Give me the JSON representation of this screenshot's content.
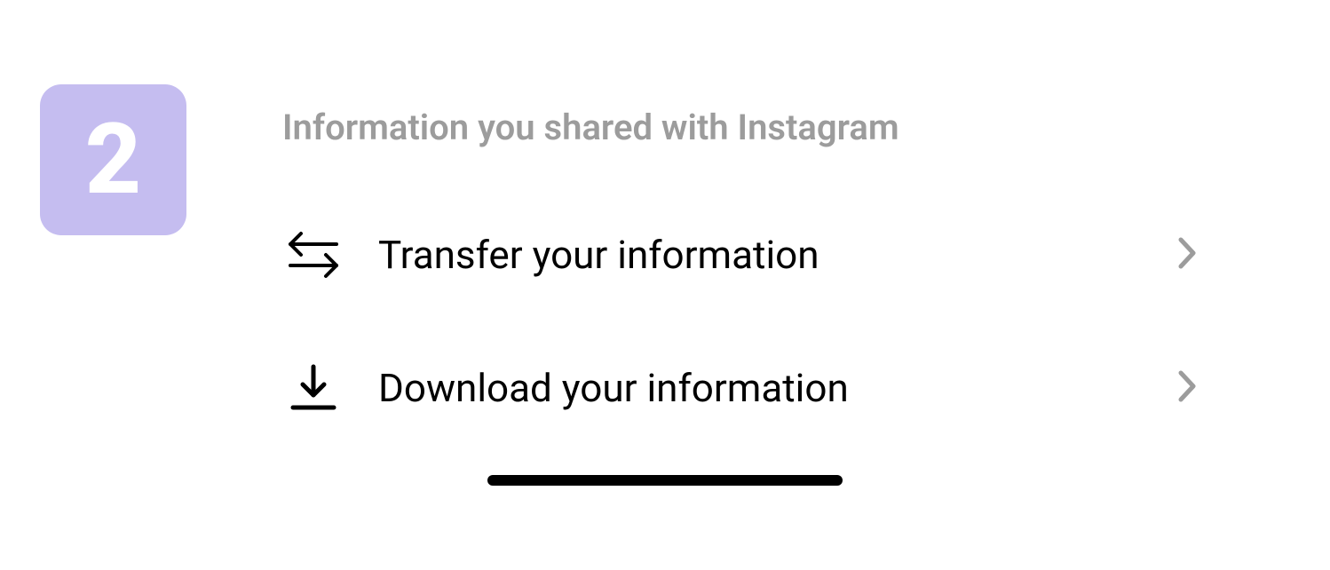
{
  "step": {
    "number": "2"
  },
  "section": {
    "header": "Information you shared with Instagram"
  },
  "items": [
    {
      "label": "Transfer your information"
    },
    {
      "label": "Download your information"
    }
  ]
}
